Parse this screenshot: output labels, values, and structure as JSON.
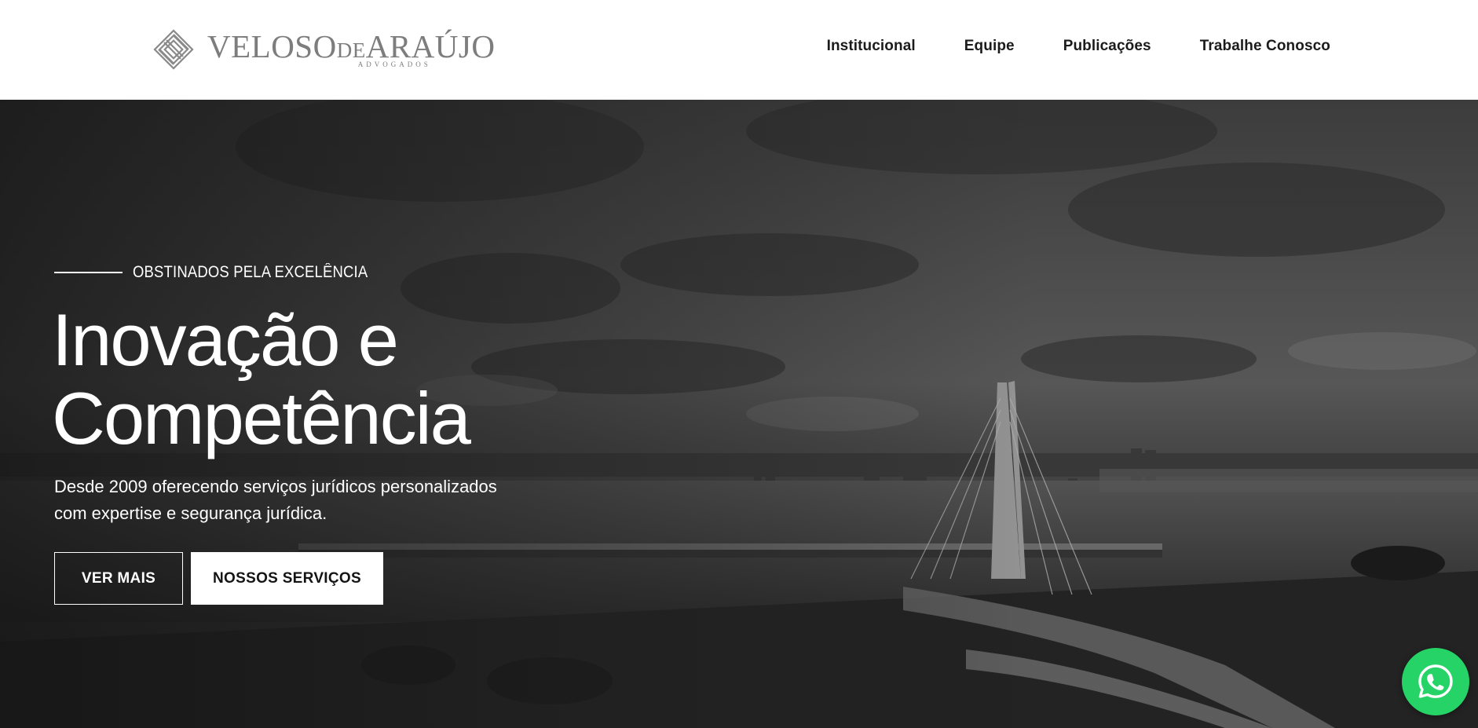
{
  "brand": {
    "name_part1": "VELOSO",
    "name_part2": "DE",
    "name_part3": "ARAÚJO",
    "subtitle": "ADVOGADOS",
    "logo_icon": "diamond-lines-icon"
  },
  "nav": {
    "items": [
      {
        "label": "Institucional"
      },
      {
        "label": "Equipe"
      },
      {
        "label": "Publicações"
      },
      {
        "label": "Trabalhe Conosco"
      }
    ]
  },
  "hero": {
    "eyebrow": "OBSTINADOS PELA EXCELÊNCIA",
    "headline_line1": "Inovação e",
    "headline_line2": "Competência",
    "lead_line1": "Desde 2009 oferecendo serviços jurídicos personalizados",
    "lead_line2": "com expertise e segurança jurídica.",
    "button_primary": "VER MAIS",
    "button_secondary": "NOSSOS SERVIÇOS",
    "background": "grayscale-city-bridge-photo"
  },
  "floating": {
    "whatsapp_icon": "whatsapp-icon",
    "whatsapp_color": "#25d366"
  },
  "colors": {
    "header_bg": "#ffffff",
    "nav_text": "#1b1b1b",
    "logo_gray": "#7d7d7d",
    "hero_text": "#ffffff"
  }
}
